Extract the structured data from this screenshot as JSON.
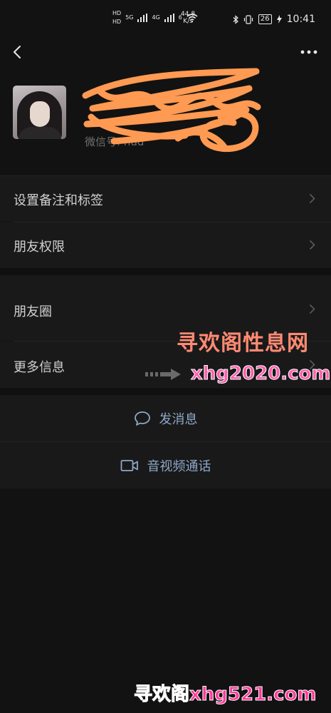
{
  "status_bar": {
    "hd1": "HD",
    "sig1": "5G",
    "hd2": "HD",
    "sig2": "4G",
    "wifi": "6",
    "speed_value": "44.8",
    "speed_unit": "K/s",
    "battery": "26",
    "time": "10:41"
  },
  "profile": {
    "nickname": "",
    "wechat_id": "微信号: hud"
  },
  "menu": {
    "set_remark": "设置备注和标签",
    "friend_permissions": "朋友权限",
    "moments": "朋友圈",
    "more_info": "更多信息"
  },
  "actions": {
    "send_message": "发消息",
    "video_call": "音视频通话"
  },
  "watermarks": {
    "site_name_cn": "寻欢阁性息网",
    "site_url_1": "xhg2020.com",
    "site_url_2": "寻欢阁xhg521.com"
  },
  "colors": {
    "background": "#121212",
    "row_background": "#191919",
    "link_blue": "#8ea7c8",
    "scribble_orange": "#ff9a52"
  }
}
